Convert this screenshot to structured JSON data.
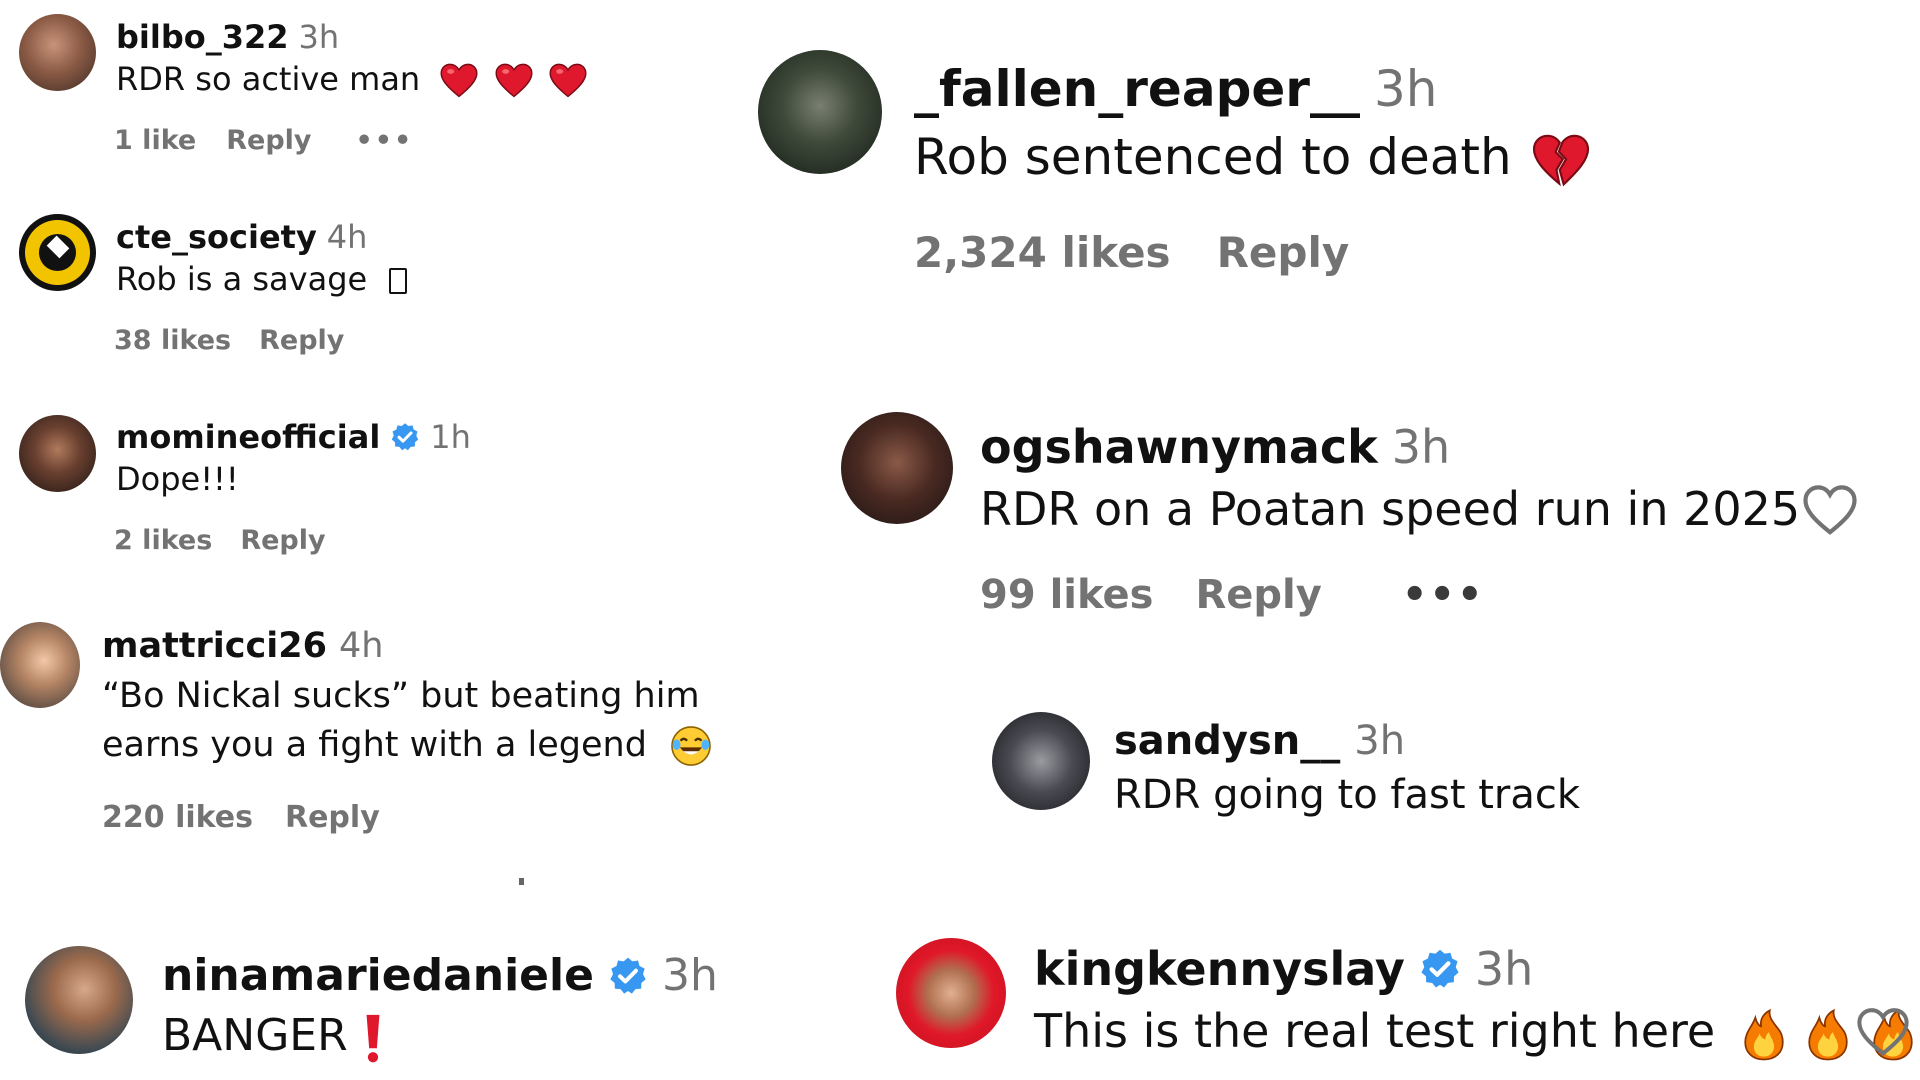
{
  "comments": [
    {
      "username": "bilbo_322",
      "time": "3h",
      "text": "RDR so active man",
      "emojis": [
        "red-heart",
        "red-heart",
        "red-heart"
      ],
      "likes": "1 like",
      "reply": "Reply",
      "more": "•••"
    },
    {
      "username": "cte_society",
      "time": "4h",
      "text": "Rob is a savage",
      "emojis": [
        "missing-glyph"
      ],
      "likes": "38 likes",
      "reply": "Reply"
    },
    {
      "username": "momineofficial",
      "verified": true,
      "time": "1h",
      "text": "Dope!!!",
      "likes": "2 likes",
      "reply": "Reply"
    },
    {
      "username": "mattricci26",
      "time": "4h",
      "text_line1": "“Bo Nickal sucks” but beating him",
      "text_line2": "earns you a fight with a legend",
      "emojis": [
        "tears-of-joy"
      ],
      "likes": "220 likes",
      "reply": "Reply"
    },
    {
      "username": "ninamariedaniele",
      "verified": true,
      "time": "3h",
      "text": "BANGER",
      "emojis": [
        "exclamation-mark"
      ]
    },
    {
      "username": "_fallen_reaper__",
      "time": "3h",
      "text": "Rob sentenced to death",
      "emojis": [
        "broken-heart"
      ],
      "likes": "2,324 likes",
      "reply": "Reply"
    },
    {
      "username": "ogshawnymack",
      "time": "3h",
      "text": "RDR on a Poatan speed run in 2025",
      "likes": "99 likes",
      "reply": "Reply",
      "more": "•••"
    },
    {
      "username": "sandysn__",
      "time": "3h",
      "text": "RDR going to fast track"
    },
    {
      "username": "kingkennyslay",
      "verified": true,
      "time": "3h",
      "text": "This is the real test right here",
      "emojis": [
        "fire",
        "fire",
        "fire"
      ]
    }
  ],
  "colors": {
    "text": "#111111",
    "muted": "#737373",
    "verified": "#3897f0",
    "heart": "#e0182d"
  }
}
